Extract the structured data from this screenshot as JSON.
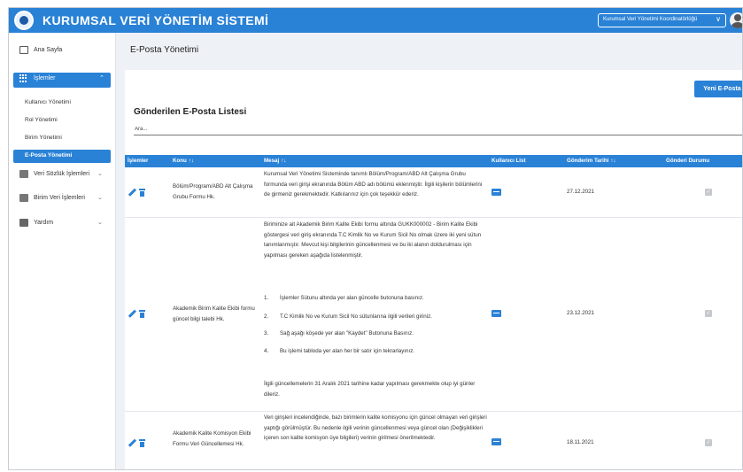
{
  "header": {
    "app_title": "KURUMSAL VERİ YÖNETİM SİSTEMİ",
    "role_selected": "Kurumsal Veri Yönetimi Koordinatörlüğü",
    "role_chevron": "∨"
  },
  "sidebar": {
    "home": "Ana Sayfa",
    "operations": "İşlemler",
    "operations_arrow": "⌃",
    "sub_items": [
      "Kullanıcı Yönetimi",
      "Rol Yönetimi",
      "Birim Yönetimi",
      "E-Posta Yönetimi"
    ],
    "dictionary": "Veri Sözlük İşlemleri",
    "unit_data": "Birim Veri İşlemleri",
    "help": "Yardım",
    "collapsed_arrow": "⌄"
  },
  "page": {
    "title": "E-Posta Yönetimi",
    "new_button": "Yeni E-Posta",
    "list_title": "Gönderilen E-Posta Listesi",
    "search_placeholder": "Ara..."
  },
  "table": {
    "headers": {
      "actions": "İşlemler",
      "subject": "Konu",
      "message": "Mesaj",
      "users": "Kullanıcı List",
      "date": "Gönderim Tarihi",
      "status": "Gönderi Durumu"
    },
    "sort_icon": "↑↓",
    "rows": [
      {
        "subject": "Bölüm/Program/ABD Alt Çalışma Grubu Formu Hk.",
        "message": "Kurumsal Veri Yönetimi Sisteminde tanımlı Bölüm/Program/ABD Alt Çalışma Grubu formunda veri girişi ekranında Bölüm ABD adı bölümü eklenmiştir. İlgili kişilerin bölümlerini de girmeniz gerekmektedir. Katkılarınız için çok teşekkür ederiz.",
        "date": "27.12.2021"
      },
      {
        "subject": "Akademik Birim Kalite Ekibi formu güncel bilgi talebi Hk.",
        "message_intro": "Biriminize ait Akademik Birim Kalite Ekibi formu altında GUKK000002 - Birim Kalite Ekibi göstergesi veri giriş ekranında T.C Kimlik No ve Kurum Sicil No olmak üzere iki  yeni sütun tanımlanmıştır. Mevcut kişi bilgilerinin güncellenmesi ve bu iki alanın doldurulması için yapılması gereken aşağıda listelenmiştir.",
        "steps": [
          "İşlemler Sütunu altında yer alan güncelle butonuna basınız.",
          "T.C Kimlik No ve Kurum Sicil No sütunlarına ilgili verileri giriniz.",
          "Sağ aşağı köşede yer alan \"Kaydet\" Butonuna Basınız.",
          "Bu işlemi tabloda yer alan her bir satır için tekrarlayınız."
        ],
        "message_outro": "İlgili güncellemelerin 31 Aralık 2021 tarihine kadar yapılması gerekmekte olup iyi günler dileriz.",
        "date": "23.12.2021"
      },
      {
        "subject": "Akademik Kalite Komisyon Ekibi Formu Veri Güncellemesi Hk.",
        "message": "Veri girişleri incelendiğinde, bazı birimlerin kalite komisyonu için güncel olmayan veri girişleri yaptığı görülmüştür. Bu nedenle ilgili verinin güncellenmesi veya güncel olan (Değişiklikleri içeren son kalite komisyon üye bilgileri) verinin girilmesi önerilmektedir.",
        "date": "18.11.2021"
      }
    ]
  },
  "colors": {
    "brand": "#2a82d7",
    "background": "#eef1f5"
  }
}
